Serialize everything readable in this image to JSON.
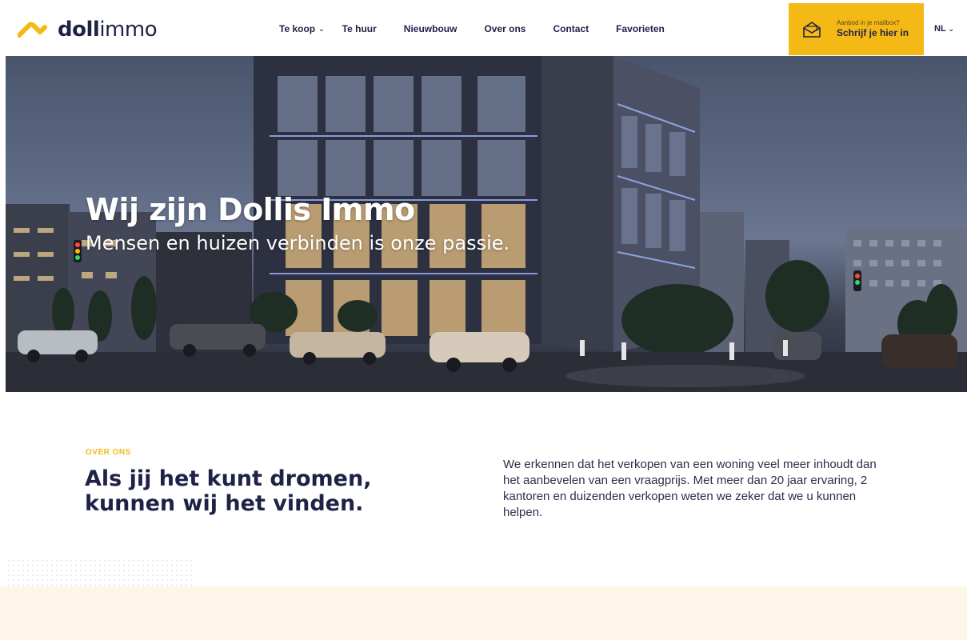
{
  "brand": {
    "logo_bold": "doll",
    "logo_light": "immo",
    "accent_color": "#f5b916",
    "navy_color": "#1e2246"
  },
  "nav": {
    "items": [
      {
        "label": "Te koop",
        "has_dropdown": true
      },
      {
        "label": "Te huur"
      },
      {
        "label": "Nieuwbouw"
      },
      {
        "label": "Over ons"
      },
      {
        "label": "Contact"
      },
      {
        "label": "Favorieten"
      }
    ]
  },
  "cta": {
    "small": "Aanbod in je mailbox?",
    "big": "Schrijf je hier in",
    "icon": "mail-icon"
  },
  "language": {
    "current": "NL"
  },
  "hero": {
    "title": "Wij zijn Dollis Immo",
    "subtitle": "Mensen en huizen verbinden is onze passie."
  },
  "about": {
    "label": "OVER ONS",
    "title_line1": "Als jij het kunt dromen,",
    "title_line2": "kunnen wij het vinden.",
    "text": "We erkennen dat het verkopen van een woning veel meer inhoudt dan het aanbevelen van een vraagprijs. Met meer dan 20 jaar ervaring, 2 kantoren en duizenden verkopen weten we zeker dat we u kunnen helpen."
  }
}
